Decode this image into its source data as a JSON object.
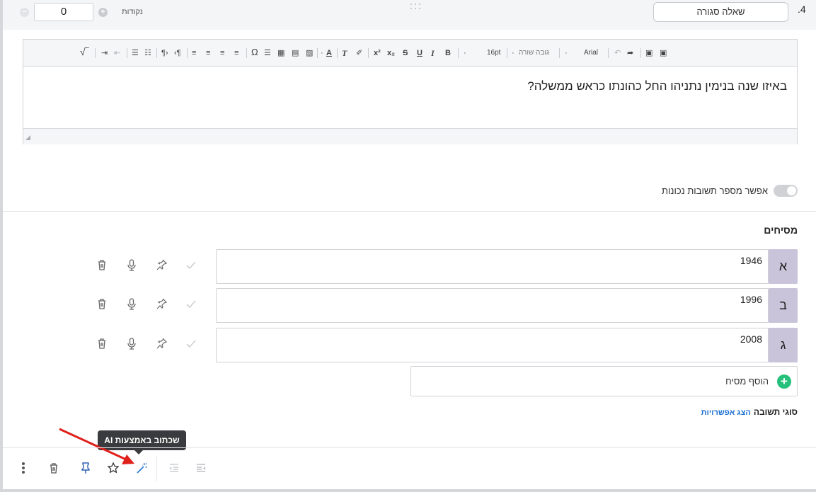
{
  "header": {
    "points_value": "0",
    "points_label": "נקודות",
    "question_type": "שאלה סגורה",
    "question_number": ".4"
  },
  "toolbar": {
    "font_name": "Arial",
    "line_height_label": "גובה שורה",
    "font_size": "16pt",
    "bold": "B",
    "italic": "I",
    "underline": "U",
    "strike": "S",
    "subscript": "x₂",
    "superscript": "x²",
    "text_color": "A",
    "special_char": "Ω"
  },
  "question": {
    "text": "באיזו שנה בנימין נתניהו החל כהונתו כראש ממשלה?"
  },
  "toggle": {
    "label": "אפשר מספר תשובות נכונות",
    "on": false
  },
  "distractors": {
    "title": "מסיחים",
    "items": [
      {
        "letter": "א",
        "value": "1946"
      },
      {
        "letter": "ב",
        "value": "1996"
      },
      {
        "letter": "ג",
        "value": "2008"
      }
    ],
    "add_label": "הוסף מסיח"
  },
  "response_types": {
    "label": "סוגי תשובה",
    "link": "הצג אפשרויות"
  },
  "tooltip": {
    "text": "שכתוב באמצעות AI"
  },
  "colors": {
    "accent_green": "#25c07a",
    "letter_bg": "#c9c4d9",
    "link_blue": "#1a6fd0",
    "pin_blue": "#2f5fb3",
    "arrow_red": "#e0201b"
  }
}
